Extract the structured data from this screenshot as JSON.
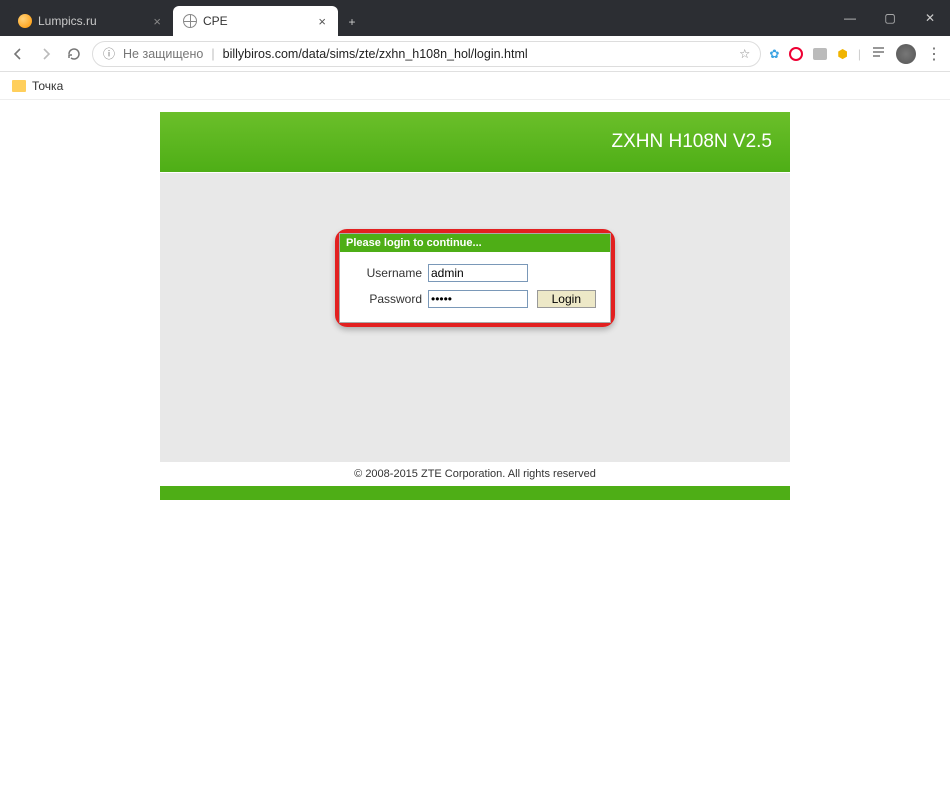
{
  "window": {
    "tabs": [
      {
        "title": "Lumpics.ru",
        "active": false
      },
      {
        "title": "CPE",
        "active": true
      }
    ],
    "newtab_label": "+"
  },
  "address_bar": {
    "not_secure_label": "Не защищено",
    "url": "billybiros.com/data/sims/zte/zxhn_h108n_hol/login.html",
    "star_title": "☆"
  },
  "bookmarks": {
    "item1": "Точка"
  },
  "router": {
    "header_title": "ZXHN H108N V2.5",
    "login_box_title": "Please login to continue...",
    "username_label": "Username",
    "username_value": "admin",
    "password_label": "Password",
    "password_value": "•••••",
    "login_button": "Login",
    "footer": "© 2008-2015 ZTE Corporation. All rights reserved"
  }
}
